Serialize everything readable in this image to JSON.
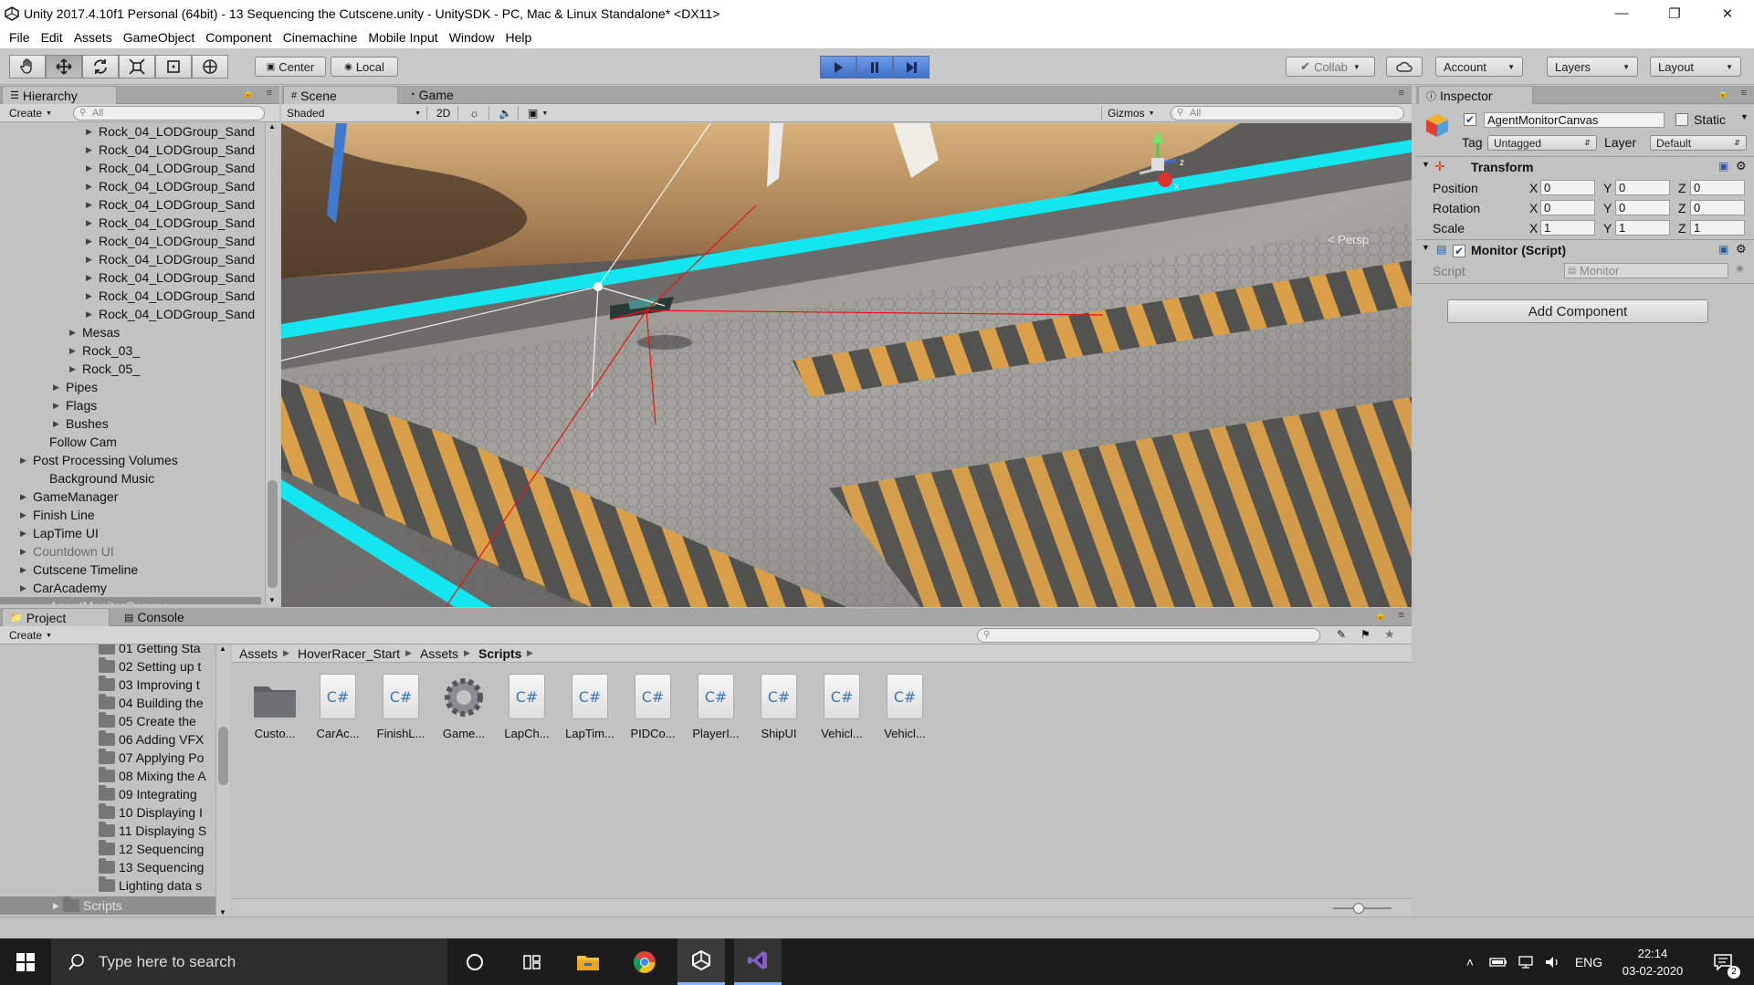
{
  "window": {
    "title": "Unity 2017.4.10f1 Personal (64bit) - 13 Sequencing the Cutscene.unity - UnitySDK - PC, Mac & Linux Standalone* <DX11>"
  },
  "menu": [
    "File",
    "Edit",
    "Assets",
    "GameObject",
    "Component",
    "Cinemachine",
    "Mobile Input",
    "Window",
    "Help"
  ],
  "toolbar": {
    "center_label": "Center",
    "local_label": "Local",
    "collab_label": "Collab",
    "account_label": "Account",
    "layers_label": "Layers",
    "layout_label": "Layout"
  },
  "hierarchy": {
    "tab_label": "Hierarchy",
    "create_label": "Create",
    "search_placeholder": "All",
    "items": [
      {
        "label": "Rock_04_LODGroup_Sand",
        "depth": 4,
        "arrow": true
      },
      {
        "label": "Rock_04_LODGroup_Sand",
        "depth": 4,
        "arrow": true
      },
      {
        "label": "Rock_04_LODGroup_Sand",
        "depth": 4,
        "arrow": true
      },
      {
        "label": "Rock_04_LODGroup_Sand",
        "depth": 4,
        "arrow": true
      },
      {
        "label": "Rock_04_LODGroup_Sand",
        "depth": 4,
        "arrow": true
      },
      {
        "label": "Rock_04_LODGroup_Sand",
        "depth": 4,
        "arrow": true
      },
      {
        "label": "Rock_04_LODGroup_Sand",
        "depth": 4,
        "arrow": true
      },
      {
        "label": "Rock_04_LODGroup_Sand",
        "depth": 4,
        "arrow": true
      },
      {
        "label": "Rock_04_LODGroup_Sand",
        "depth": 4,
        "arrow": true
      },
      {
        "label": "Rock_04_LODGroup_Sand",
        "depth": 4,
        "arrow": true
      },
      {
        "label": "Rock_04_LODGroup_Sand",
        "depth": 4,
        "arrow": true
      },
      {
        "label": "Mesas",
        "depth": 3,
        "arrow": true
      },
      {
        "label": "Rock_03_",
        "depth": 3,
        "arrow": true
      },
      {
        "label": "Rock_05_",
        "depth": 3,
        "arrow": true
      },
      {
        "label": "Pipes",
        "depth": 2,
        "arrow": true
      },
      {
        "label": "Flags",
        "depth": 2,
        "arrow": true
      },
      {
        "label": "Bushes",
        "depth": 2,
        "arrow": true
      },
      {
        "label": "Follow Cam",
        "depth": 1,
        "arrow": false
      },
      {
        "label": "Post Processing Volumes",
        "depth": 0,
        "arrow": true
      },
      {
        "label": "Background Music",
        "depth": 1,
        "arrow": false
      },
      {
        "label": "GameManager",
        "depth": 0,
        "arrow": true
      },
      {
        "label": "Finish Line",
        "depth": 0,
        "arrow": true
      },
      {
        "label": "LapTime UI",
        "depth": 0,
        "arrow": true
      },
      {
        "label": "Countdown UI",
        "depth": 0,
        "arrow": true,
        "disabled": true
      },
      {
        "label": "Cutscene Timeline",
        "depth": 0,
        "arrow": true
      },
      {
        "label": "CarAcademy",
        "depth": 0,
        "arrow": true
      },
      {
        "label": "AgentMonitorCanvas",
        "depth": 1,
        "arrow": false,
        "selected": true
      }
    ]
  },
  "scene": {
    "tab_scene": "Scene",
    "tab_game": "Game",
    "shading_mode": "Shaded",
    "mode_2d": "2D",
    "gizmos_label": "Gizmos",
    "search_placeholder": "All",
    "persp_label": "< Persp",
    "colors": {
      "accent_cyan": "#14e6f0",
      "hazard_orange": "#e8a43a",
      "sand": "#c99a63"
    }
  },
  "inspector": {
    "tab_label": "Inspector",
    "object_name": "AgentMonitorCanvas",
    "static_label": "Static",
    "tag_label": "Tag",
    "tag_value": "Untagged",
    "layer_label": "Layer",
    "layer_value": "Default",
    "transform": {
      "title": "Transform",
      "position_label": "Position",
      "rotation_label": "Rotation",
      "scale_label": "Scale",
      "position": {
        "x": "0",
        "y": "0",
        "z": "0"
      },
      "rotation": {
        "x": "0",
        "y": "0",
        "z": "0"
      },
      "scale": {
        "x": "1",
        "y": "1",
        "z": "1"
      }
    },
    "monitor": {
      "title": "Monitor (Script)",
      "script_label": "Script",
      "script_value": "Monitor"
    },
    "add_component_label": "Add Component"
  },
  "project": {
    "tab_project": "Project",
    "tab_console": "Console",
    "create_label": "Create",
    "tree": [
      "01 Getting Sta",
      "02 Setting up t",
      "03 Improving t",
      "04 Building the",
      "05 Create the",
      "06 Adding VFX",
      "07 Applying Po",
      "08 Mixing the A",
      "09 Integrating",
      "10 Displaying I",
      "11 Displaying S",
      "12 Sequencing",
      "13 Sequencing",
      "Lighting data s"
    ],
    "tree_scripts_label": "Scripts",
    "breadcrumb": [
      "Assets",
      "HoverRacer_Start",
      "Assets",
      "Scripts"
    ],
    "assets": [
      {
        "label": "Custo...",
        "kind": "folder"
      },
      {
        "label": "CarAc...",
        "kind": "cs"
      },
      {
        "label": "FinishL...",
        "kind": "cs"
      },
      {
        "label": "Game...",
        "kind": "gear"
      },
      {
        "label": "LapCh...",
        "kind": "cs"
      },
      {
        "label": "LapTim...",
        "kind": "cs"
      },
      {
        "label": "PIDCo...",
        "kind": "cs"
      },
      {
        "label": "PlayerI...",
        "kind": "cs"
      },
      {
        "label": "ShipUI",
        "kind": "cs"
      },
      {
        "label": "Vehicl...",
        "kind": "cs"
      },
      {
        "label": "Vehicl...",
        "kind": "cs"
      }
    ],
    "cs_glyph": "C#"
  },
  "taskbar": {
    "search_placeholder": "Type here to search",
    "language": "ENG",
    "time": "22:14",
    "date": "03-02-2020"
  }
}
